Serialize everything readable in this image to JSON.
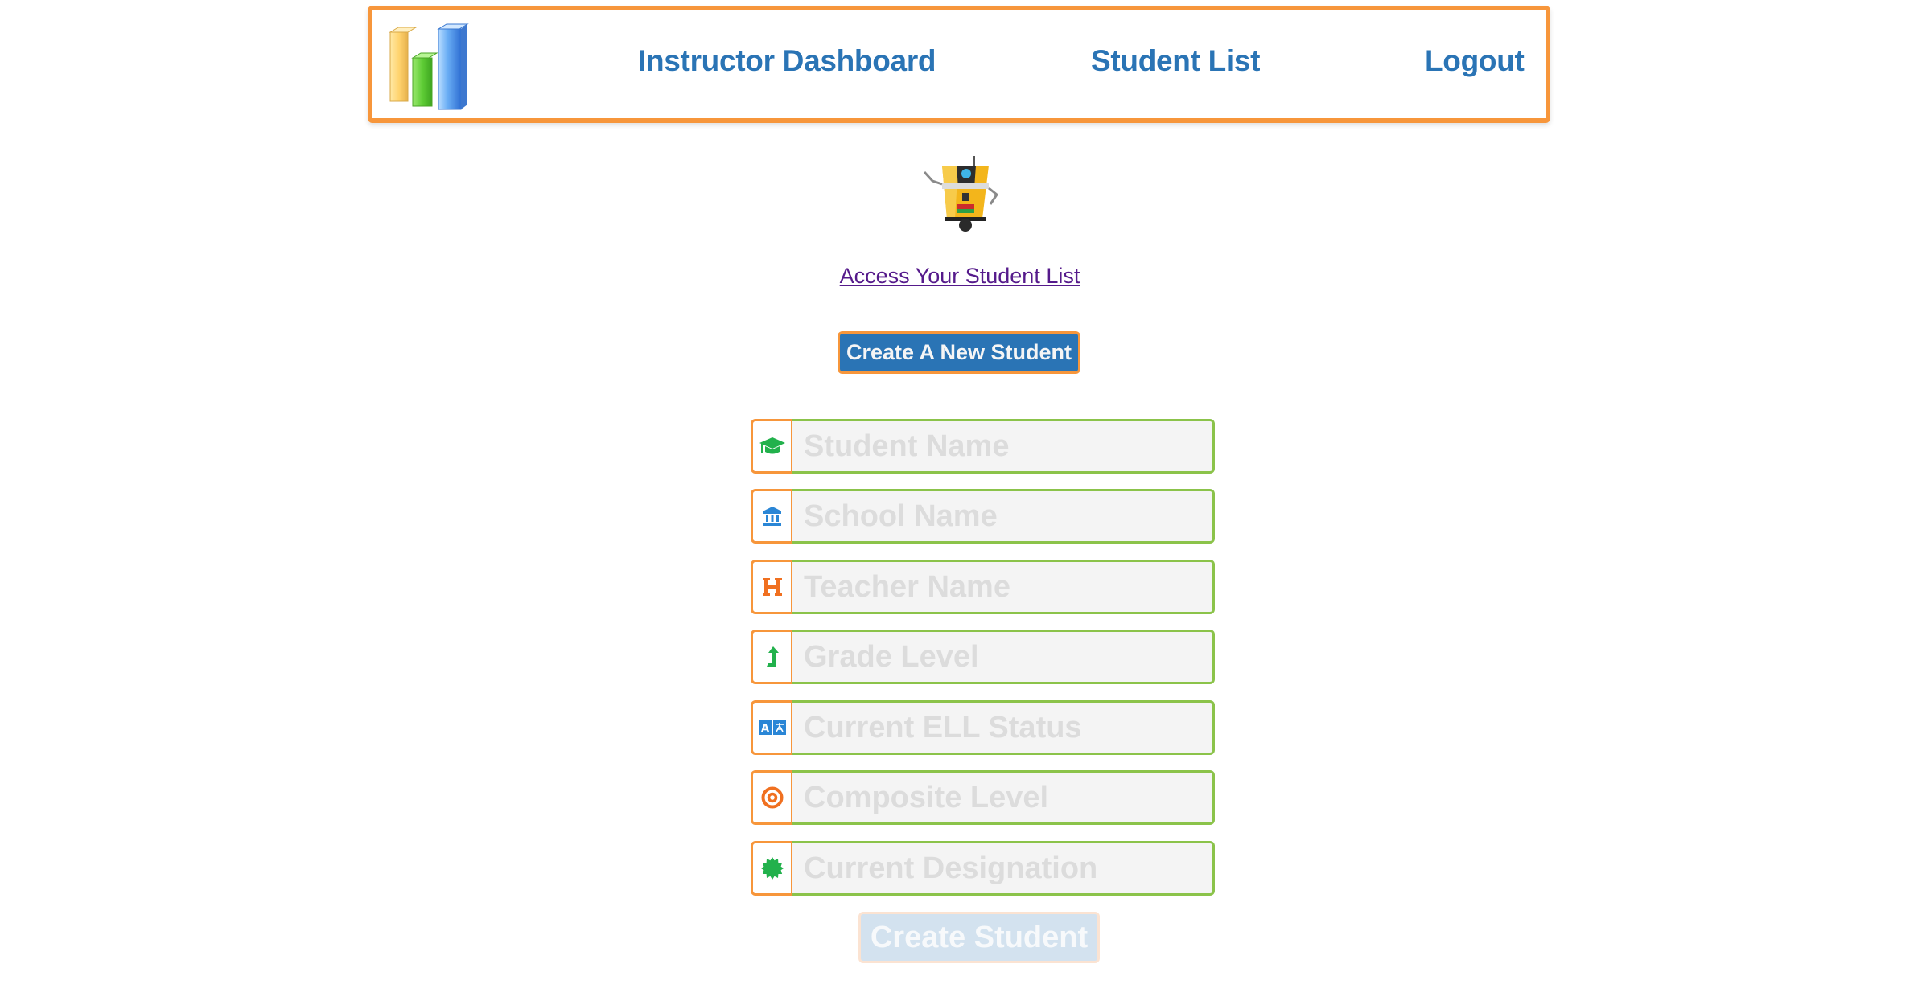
{
  "header": {
    "logo_icon": "bar-chart-logo",
    "nav": {
      "dashboard": "Instructor Dashboard",
      "student_list": "Student List",
      "logout": "Logout"
    }
  },
  "mascot_icon": "robot-mascot",
  "access_link": "Access Your Student List",
  "new_student_button": "Create A New Student",
  "form": {
    "fields": [
      {
        "placeholder": "Student Name",
        "icon": "graduation-cap-icon",
        "value": ""
      },
      {
        "placeholder": "School Name",
        "icon": "university-icon",
        "value": ""
      },
      {
        "placeholder": "Teacher Name",
        "icon": "h-letter-icon",
        "value": ""
      },
      {
        "placeholder": "Grade Level",
        "icon": "level-up-arrow-icon",
        "value": ""
      },
      {
        "placeholder": "Current ELL Status",
        "icon": "translate-icon",
        "value": ""
      },
      {
        "placeholder": "Composite Level",
        "icon": "target-icon",
        "value": ""
      },
      {
        "placeholder": "Current Designation",
        "icon": "certificate-badge-icon",
        "value": ""
      }
    ],
    "submit_label": "Create Student"
  },
  "colors": {
    "accent_orange": "#f7963b",
    "brand_blue": "#2a74b5",
    "input_border_green": "#8bc34a",
    "visited_link": "#551a8b",
    "icon_green": "#22b14c",
    "icon_blue": "#2a86d6",
    "icon_orange": "#f07020"
  }
}
